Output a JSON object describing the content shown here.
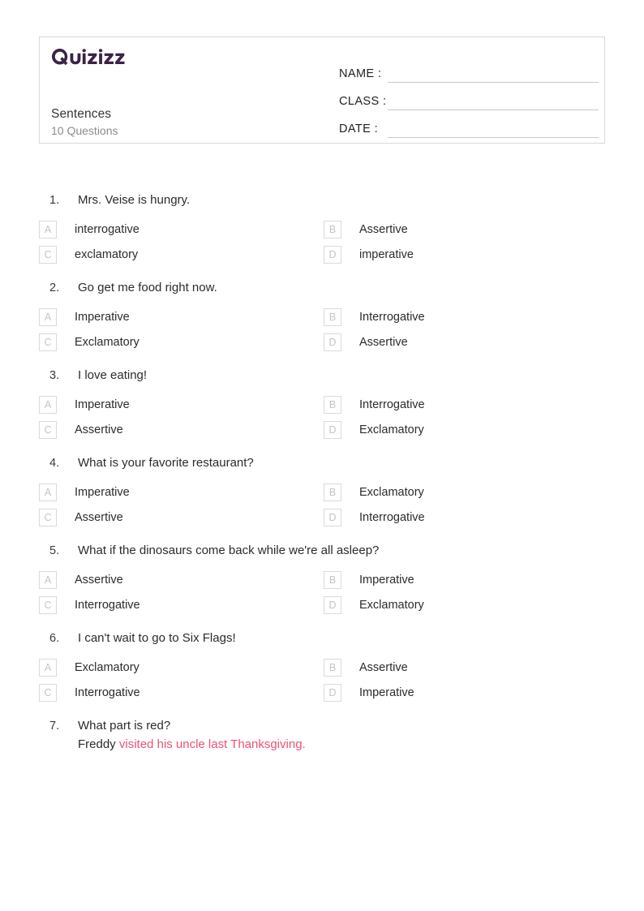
{
  "header": {
    "logo_text": "Quizizz",
    "logo_color": "#3b2447",
    "title": "Sentences",
    "subtitle": "10 Questions",
    "fields": [
      {
        "label": "NAME :",
        "value": ""
      },
      {
        "label": "CLASS :",
        "value": ""
      },
      {
        "label": "DATE  :",
        "value": ""
      }
    ]
  },
  "accent_color": "#ee5177",
  "questions": [
    {
      "number": "1.",
      "text": "Mrs. Veise is hungry.",
      "options": [
        {
          "letter": "A",
          "label": "interrogative"
        },
        {
          "letter": "B",
          "label": "Assertive"
        },
        {
          "letter": "C",
          "label": "exclamatory"
        },
        {
          "letter": "D",
          "label": "imperative"
        }
      ]
    },
    {
      "number": "2.",
      "text": "Go get me food right now.",
      "options": [
        {
          "letter": "A",
          "label": "Imperative"
        },
        {
          "letter": "B",
          "label": "Interrogative"
        },
        {
          "letter": "C",
          "label": "Exclamatory"
        },
        {
          "letter": "D",
          "label": "Assertive"
        }
      ]
    },
    {
      "number": "3.",
      "text": "I love eating!",
      "options": [
        {
          "letter": "A",
          "label": "Imperative"
        },
        {
          "letter": "B",
          "label": "Interrogative"
        },
        {
          "letter": "C",
          "label": "Assertive"
        },
        {
          "letter": "D",
          "label": "Exclamatory"
        }
      ]
    },
    {
      "number": "4.",
      "text": "What is your favorite restaurant?",
      "options": [
        {
          "letter": "A",
          "label": "Imperative"
        },
        {
          "letter": "B",
          "label": "Exclamatory"
        },
        {
          "letter": "C",
          "label": "Assertive"
        },
        {
          "letter": "D",
          "label": "Interrogative"
        }
      ]
    },
    {
      "number": "5.",
      "text": "What if the dinosaurs come back while we're all asleep?",
      "options": [
        {
          "letter": "A",
          "label": "Assertive"
        },
        {
          "letter": "B",
          "label": "Imperative"
        },
        {
          "letter": "C",
          "label": "Interrogative"
        },
        {
          "letter": "D",
          "label": "Exclamatory"
        }
      ]
    },
    {
      "number": "6.",
      "text": "I can't wait to go to Six Flags!",
      "options": [
        {
          "letter": "A",
          "label": "Exclamatory"
        },
        {
          "letter": "B",
          "label": "Assertive"
        },
        {
          "letter": "C",
          "label": "Interrogative"
        },
        {
          "letter": "D",
          "label": "Imperative"
        }
      ]
    },
    {
      "number": "7.",
      "text": "What part is red?",
      "text_line2_black": "Freddy ",
      "text_line2_red": "visited his uncle last Thanksgiving.",
      "options": []
    }
  ]
}
